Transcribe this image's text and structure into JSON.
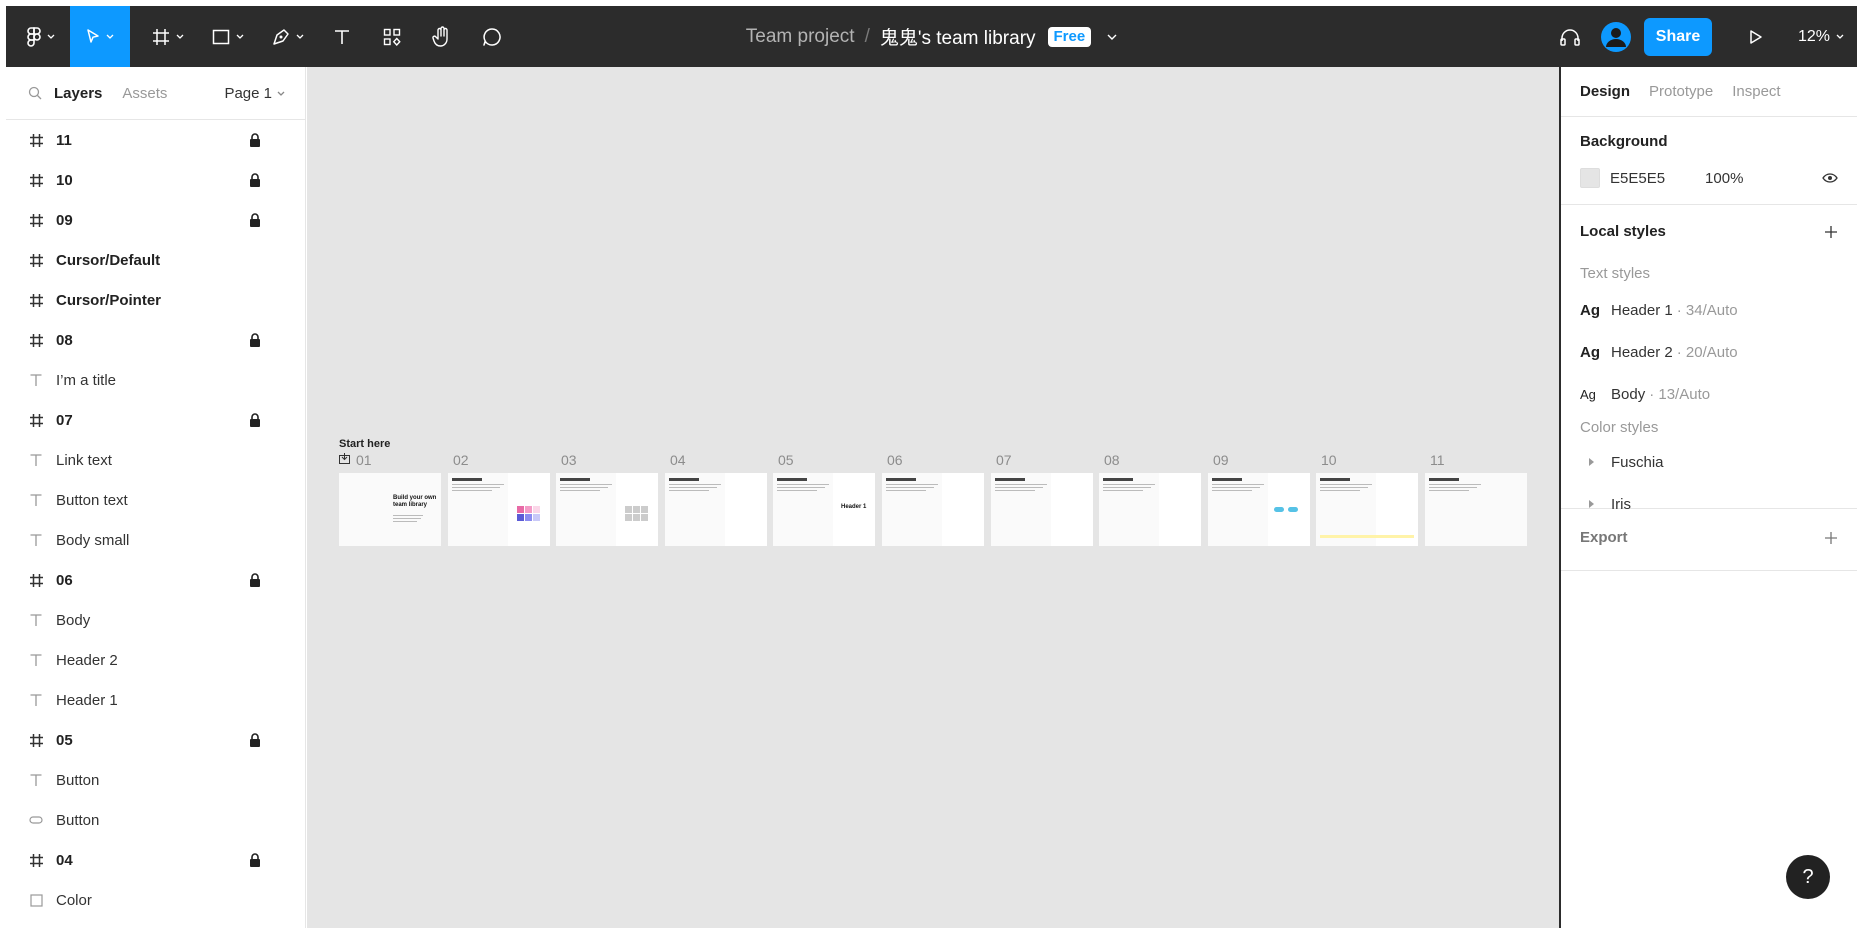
{
  "toolbar": {
    "project": "Team project",
    "separator": "/",
    "file_name": "鬼鬼's team library",
    "plan_badge": "Free",
    "share_label": "Share",
    "zoom": "12%"
  },
  "left_panel": {
    "tabs": [
      {
        "label": "Layers",
        "active": true
      },
      {
        "label": "Assets",
        "active": false
      }
    ],
    "page": "Page 1",
    "layers": [
      {
        "name": "11",
        "kind": "frame",
        "locked": true
      },
      {
        "name": "10",
        "kind": "frame",
        "locked": true
      },
      {
        "name": "09",
        "kind": "frame",
        "locked": true
      },
      {
        "name": "Cursor/Default",
        "kind": "frame",
        "locked": false
      },
      {
        "name": "Cursor/Pointer",
        "kind": "frame",
        "locked": false
      },
      {
        "name": "08",
        "kind": "frame",
        "locked": true
      },
      {
        "name": "I’m a title",
        "kind": "text",
        "locked": false
      },
      {
        "name": "07",
        "kind": "frame",
        "locked": true
      },
      {
        "name": "Link text",
        "kind": "text",
        "locked": false
      },
      {
        "name": "Button text",
        "kind": "text",
        "locked": false
      },
      {
        "name": "Body small",
        "kind": "text",
        "locked": false
      },
      {
        "name": "06",
        "kind": "frame",
        "locked": true
      },
      {
        "name": "Body",
        "kind": "text",
        "locked": false
      },
      {
        "name": "Header 2",
        "kind": "text",
        "locked": false
      },
      {
        "name": "Header 1",
        "kind": "text",
        "locked": false
      },
      {
        "name": "05",
        "kind": "frame",
        "locked": true
      },
      {
        "name": "Button",
        "kind": "text",
        "locked": false
      },
      {
        "name": "Button",
        "kind": "ellipse",
        "locked": false
      },
      {
        "name": "04",
        "kind": "frame",
        "locked": true
      },
      {
        "name": "Color",
        "kind": "rect",
        "locked": false
      }
    ]
  },
  "canvas": {
    "start_label": "Start here",
    "frames": [
      "01",
      "02",
      "03",
      "04",
      "05",
      "06",
      "07",
      "08",
      "09",
      "10",
      "11"
    ],
    "frame01_title": "Build your own team library",
    "frame05_header1": "Header 1"
  },
  "right_panel": {
    "tabs": [
      {
        "label": "Design",
        "active": true
      },
      {
        "label": "Prototype",
        "active": false
      },
      {
        "label": "Inspect",
        "active": false
      }
    ],
    "background": {
      "title": "Background",
      "hex": "E5E5E5",
      "opacity": "100%"
    },
    "local_styles": {
      "title": "Local styles",
      "text_styles_label": "Text styles",
      "text_styles": [
        {
          "glyph": "Ag",
          "name": "Header 1",
          "meta": "· 34/Auto"
        },
        {
          "glyph": "Ag",
          "name": "Header 2",
          "meta": "· 20/Auto"
        },
        {
          "glyph": "Ag",
          "name": "Body",
          "meta": "· 13/Auto"
        }
      ],
      "color_styles_label": "Color styles",
      "color_styles": [
        "Fuschia",
        "Iris"
      ]
    },
    "export": {
      "title": "Export"
    }
  },
  "help_label": "?",
  "colors": {
    "toolbar_bg": "#2c2c2c",
    "accent": "#0d99ff",
    "canvas_bg": "#e5e5e5"
  }
}
